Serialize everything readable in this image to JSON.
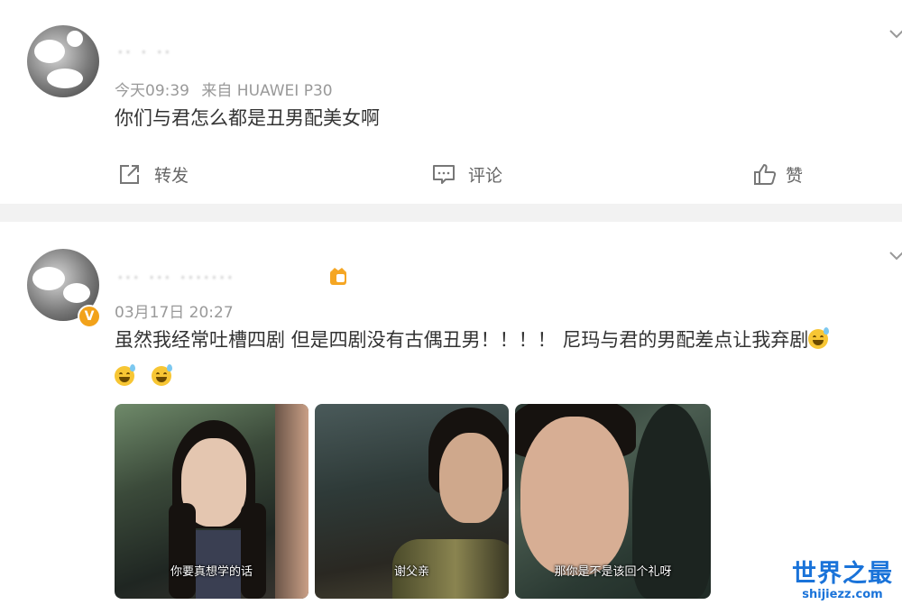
{
  "posts": [
    {
      "user": {
        "name": "·· · ··"
      },
      "meta": {
        "time": "今天09:39",
        "source": "来自 HUAWEI P30"
      },
      "text": "你们与君怎么都是丑男配美女啊",
      "actions": {
        "repost": "转发",
        "comment": "评论",
        "like": "赞"
      }
    },
    {
      "user": {
        "name": "··· ··· ·······",
        "verified": "V"
      },
      "meta": {
        "time": "03月17日 20:27"
      },
      "text_line1": "虽然我经常吐槽四剧 但是四剧没有古偶丑男！！！！ 尼玛与君的男配差点让我弃剧",
      "images": [
        {
          "caption": "你要真想学的话"
        },
        {
          "caption": "谢父亲"
        },
        {
          "caption": "那你是不是该回个礼呀"
        }
      ]
    }
  ],
  "watermark": {
    "title": "世界之最",
    "url": "shijiezz.com"
  },
  "icons": {
    "repost": "share-icon",
    "comment": "comment-icon",
    "like": "thumbs-up-icon",
    "more": "chevron-down-icon",
    "emoji": "sweat-smile-emoji"
  },
  "colors": {
    "accent": "#1a73d9",
    "meta": "#999999",
    "text": "#333333",
    "separator": "#f2f2f2"
  }
}
